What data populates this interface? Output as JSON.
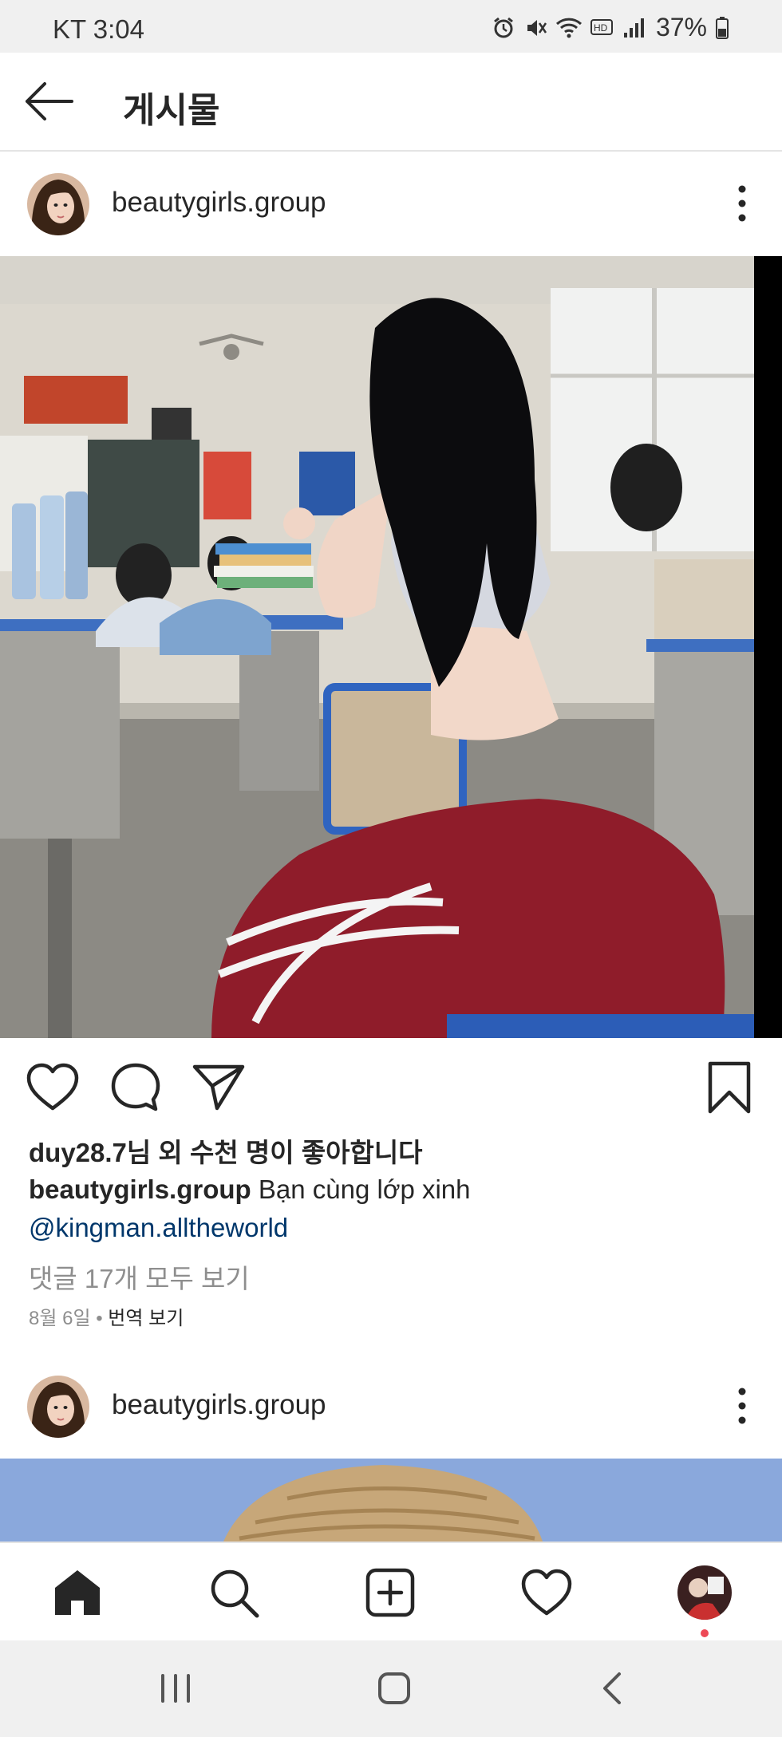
{
  "status_bar": {
    "carrier": "KT",
    "time": "3:04",
    "battery_percent": "37%",
    "icons": [
      "alarm-icon",
      "mute-icon",
      "wifi-icon",
      "hd-icon",
      "signal-icon",
      "battery-icon"
    ]
  },
  "header": {
    "back_icon": "arrow-left-icon",
    "title": "게시물"
  },
  "post": {
    "username": "beautygirls.group",
    "likes_user": "duy28.7",
    "likes_rest": "님 외 수천 명이 좋아합니다",
    "caption_user": "beautygirls.group",
    "caption_text": " Bạn cùng lớp xinh",
    "mention": "@kingman.alltheworld",
    "view_comments": "댓글 17개 모두 보기",
    "date": "8월 6일",
    "separator": " • ",
    "translate": "번역 보기"
  },
  "next_post": {
    "username": "beautygirls.group"
  },
  "bottom_nav": {
    "items": [
      "home-icon",
      "search-icon",
      "add-post-icon",
      "activity-heart-icon",
      "profile-avatar"
    ],
    "notification_color": "#ed4956"
  },
  "system_nav": {
    "items": [
      "recent-apps-icon",
      "home-button-icon",
      "back-icon"
    ]
  }
}
